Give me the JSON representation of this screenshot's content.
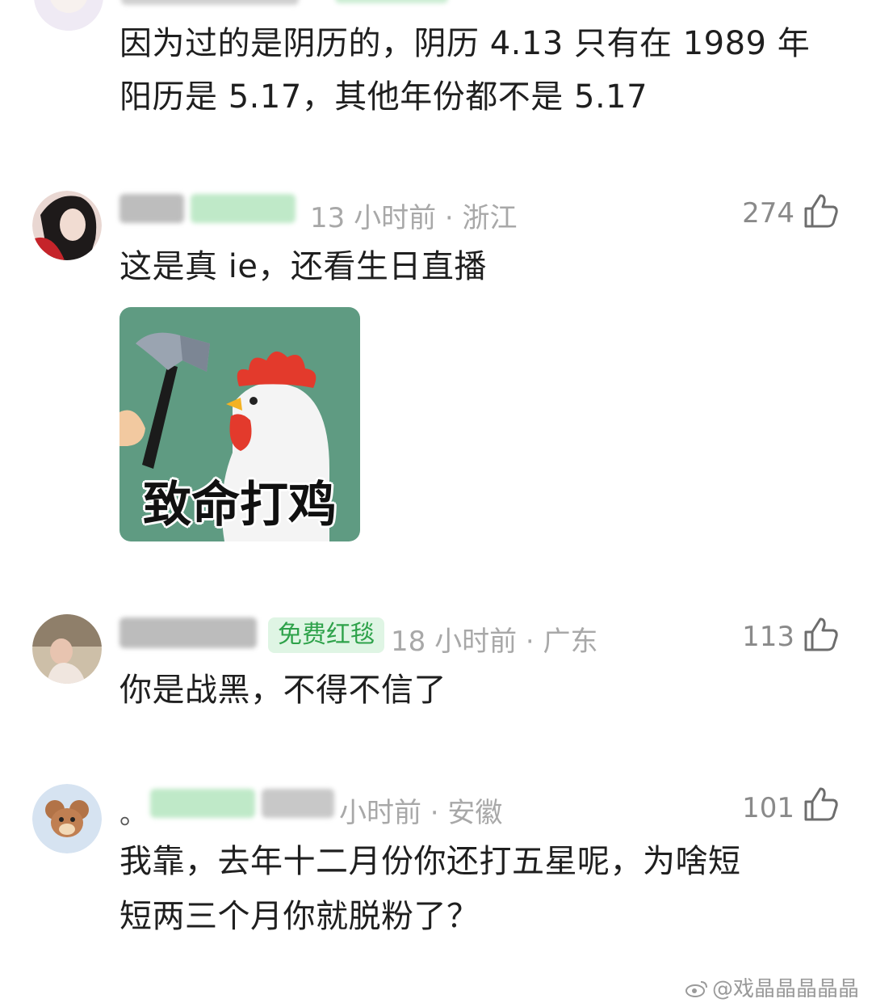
{
  "comments": [
    {
      "text_lines": [
        "因为过的是阴历的，阴历 4.13 只有在 1989 年",
        "阳历是 5.17，其他年份都不是 5.17"
      ]
    },
    {
      "meta": "13 小时前 · 浙江",
      "likes": "274",
      "text_lines": [
        "这是真 ie，还看生日直播"
      ],
      "sticker_caption": "致命打鸡"
    },
    {
      "badge": "免费红毯",
      "meta": "18 小时前 · 广东",
      "likes": "113",
      "text_lines": [
        "你是战黑，不得不信了"
      ]
    },
    {
      "name_prefix": "。",
      "meta": "小时前 · 安徽",
      "likes": "101",
      "text_lines": [
        "我靠，去年十二月份你还打五星呢，为啥短",
        "短两三个月你就脱粉了？"
      ]
    }
  ],
  "watermark": "@戏晶晶晶晶晶",
  "icons": {
    "like": "thumbs-up-icon",
    "weibo": "weibo-logo-icon"
  },
  "colors": {
    "text": "#1f1f1f",
    "meta": "#a8a8a8",
    "badge_bg": "#dff5e4",
    "badge_text": "#2ea24a",
    "sticker_bg": "#5f9b82"
  }
}
